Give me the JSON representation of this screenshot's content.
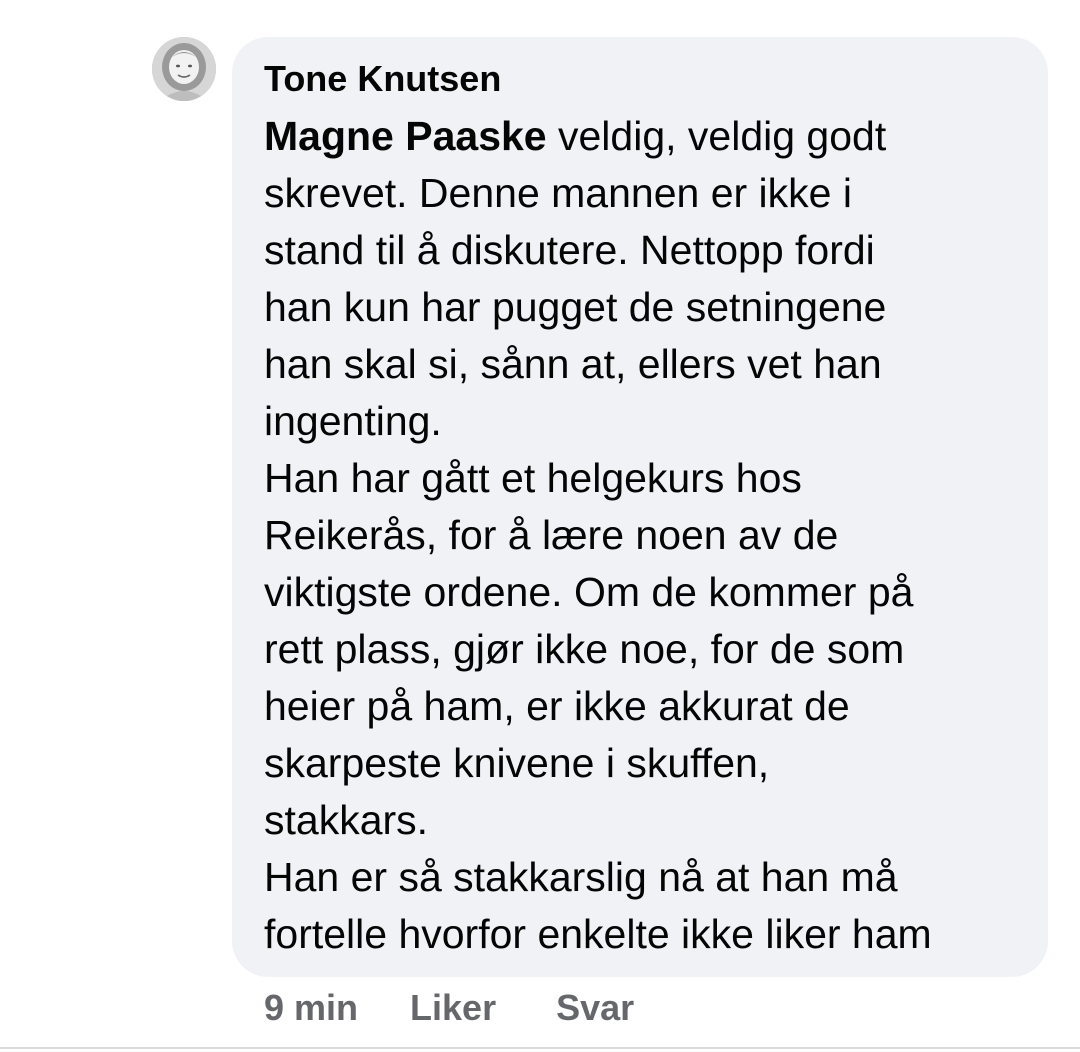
{
  "comment": {
    "avatar_icon": "profile-photo-icon",
    "author": "Tone Knutsen",
    "mention": "Magne Paaske",
    "lines": [
      " veldig, veldig godt",
      "skrevet. Denne mannen er ikke i",
      "stand til å diskutere. Nettopp fordi",
      "han kun har pugget de setningene",
      "han skal si, sånn at, ellers vet han",
      "ingenting.",
      "Han har gått et helgekurs hos",
      "Reikerås, for å lære noen av de",
      "viktigste ordene. Om de kommer på",
      "rett plass, gjør ikke noe, for de som",
      "heier på ham, er ikke akkurat de",
      "skarpeste knivene i skuffen,",
      "stakkars.",
      "Han er så stakkarslig nå at han må",
      "fortelle hvorfor enkelte ikke liker ham"
    ]
  },
  "actions": {
    "time": "9 min",
    "like_label": "Liker",
    "reply_label": "Svar"
  },
  "colors": {
    "bubble_bg": "#f0f2f5",
    "text": "#050505",
    "secondary_text": "#65676b"
  }
}
